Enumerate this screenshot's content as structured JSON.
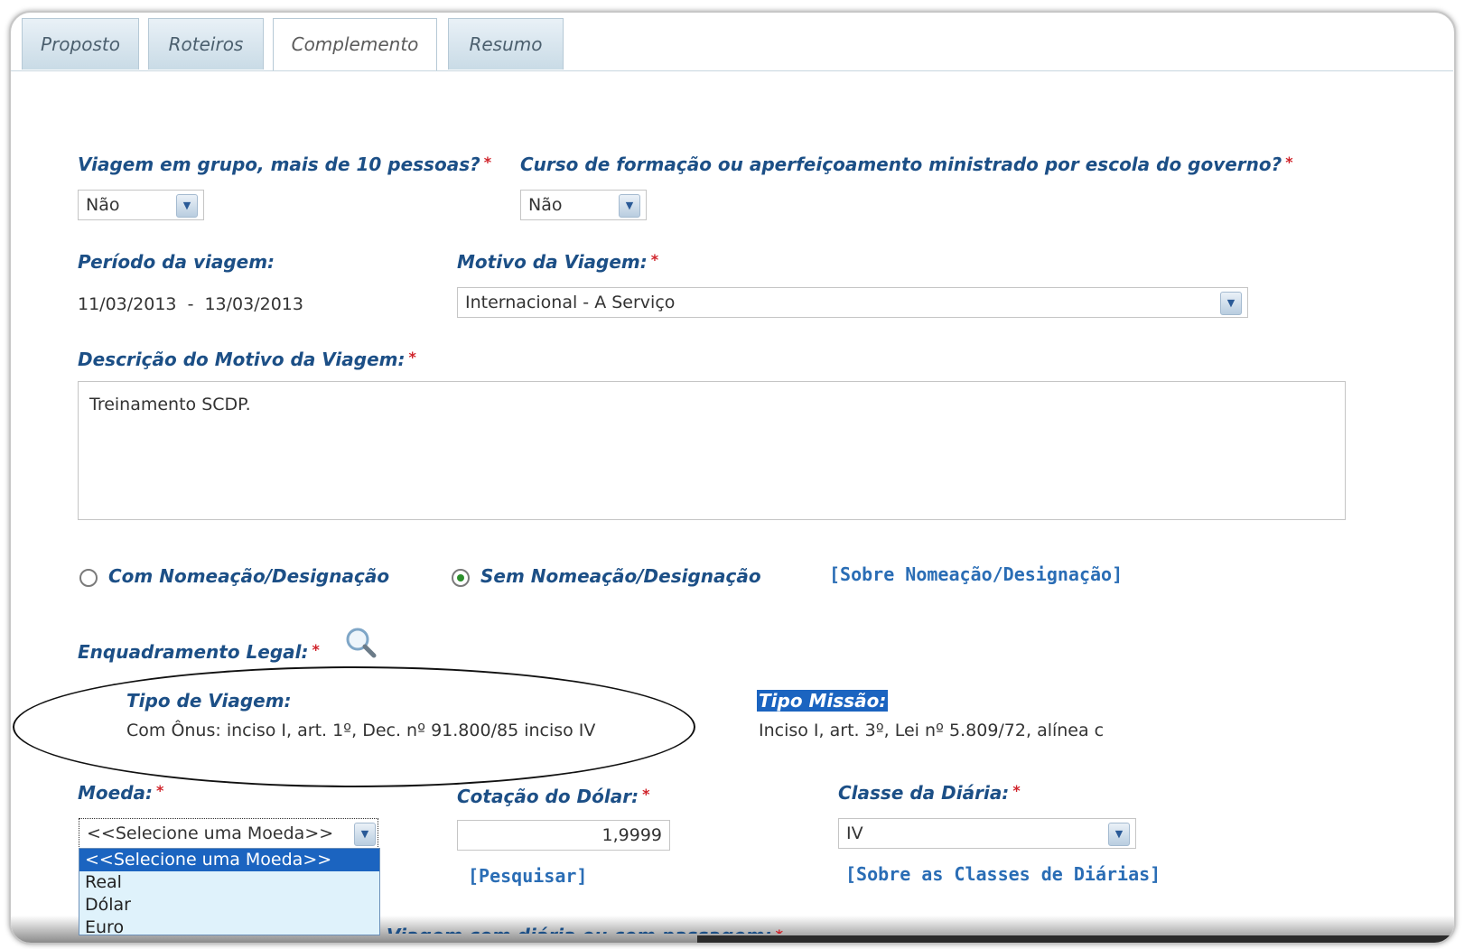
{
  "tabs": [
    "Proposto",
    "Roteiros",
    "Complemento",
    "Resumo"
  ],
  "active_tab": "Complemento",
  "grupo": {
    "label": "Viagem em grupo, mais de 10 pessoas?",
    "value": "Não"
  },
  "curso": {
    "label": "Curso de formação ou aperfeiçoamento ministrado por escola do governo?",
    "value": "Não"
  },
  "periodo": {
    "label": "Período da viagem:",
    "start": "11/03/2013",
    "sep": "-",
    "end": "13/03/2013"
  },
  "motivo": {
    "label": "Motivo da Viagem:",
    "value": "Internacional - A Serviço"
  },
  "descricao": {
    "label": "Descrição do Motivo da Viagem:",
    "value": "Treinamento SCDP."
  },
  "nomeacao": {
    "option_com": "Com Nomeação/Designação",
    "option_sem": "Sem Nomeação/Designação",
    "selected": "Sem Nomeação/Designação",
    "link": "[Sobre Nomeação/Designação]"
  },
  "enquadramento": {
    "label": "Enquadramento Legal:",
    "tipo_viagem_label": "Tipo de Viagem:",
    "tipo_viagem_value": "Com Ônus: inciso I, art. 1º, Dec. nº 91.800/85 inciso IV",
    "tipo_missao_label": "Tipo Missão:",
    "tipo_missao_value": "Inciso I, art. 3º, Lei nº 5.809/72, alínea c"
  },
  "moeda": {
    "label": "Moeda:",
    "value": "<<Selecione uma Moeda>>",
    "options": [
      "<<Selecione uma Moeda>>",
      "Real",
      "Dólar",
      "Euro"
    ]
  },
  "cotacao": {
    "label": "Cotação do Dólar:",
    "value": "1,9999",
    "link": "[Pesquisar]"
  },
  "classe": {
    "label": "Classe da Diária:",
    "value": "IV",
    "link": "[Sobre as Classes de Diárias]"
  },
  "cutoff_label": "Viagem com diária ou com passagem:",
  "colors": {
    "label_blue": "#1c4f86",
    "link_blue": "#2a6db5",
    "required_red": "#d0232a",
    "highlight": "#1b64c0"
  },
  "icons": {
    "dropdown_arrow": "chevron-down-icon",
    "search": "magnifier-icon",
    "arrow_glyph": "▼"
  }
}
